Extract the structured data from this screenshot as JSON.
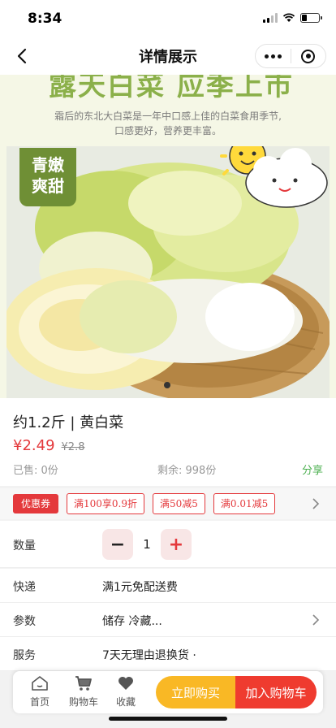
{
  "status_bar": {
    "time": "8:34",
    "battery_level": 0.3
  },
  "nav": {
    "title": "详情展示"
  },
  "hero": {
    "headline": "露天白菜 应季上市",
    "subtitle_line1": "霜后的东北大白菜是一年中口感上佳的白菜食用季节,",
    "subtitle_line2": "口感更好，营养更丰富。",
    "badge_line1": "青嫩",
    "badge_line2": "爽甜"
  },
  "product": {
    "title": "约1.2斤 | 黄白菜",
    "price": "¥2.49",
    "original_price": "¥2.8",
    "sold": "已售: 0份",
    "remaining": "剩余: 998份",
    "share": "分享"
  },
  "coupons": {
    "label": "优惠券",
    "items": [
      "满100享0.9折",
      "满50减5",
      "满0.01减5"
    ]
  },
  "quantity": {
    "label": "数量",
    "value": "1",
    "minus": "−",
    "plus": "+"
  },
  "shipping": {
    "label": "快递",
    "value": "满1元免配送费"
  },
  "params": {
    "label": "参数",
    "value": "储存 冷藏..."
  },
  "service": {
    "label": "服务",
    "value": "7天无理由退换货 ·"
  },
  "bottom_bar": {
    "home": "首页",
    "cart": "购物车",
    "favorite": "收藏",
    "buy_now": "立即购买",
    "add_to_cart": "加入购物车"
  },
  "colors": {
    "price_red": "#e4393c",
    "share_green": "#4cb050",
    "buy_yellow": "#f9b825",
    "cart_red": "#ef3b2f"
  }
}
